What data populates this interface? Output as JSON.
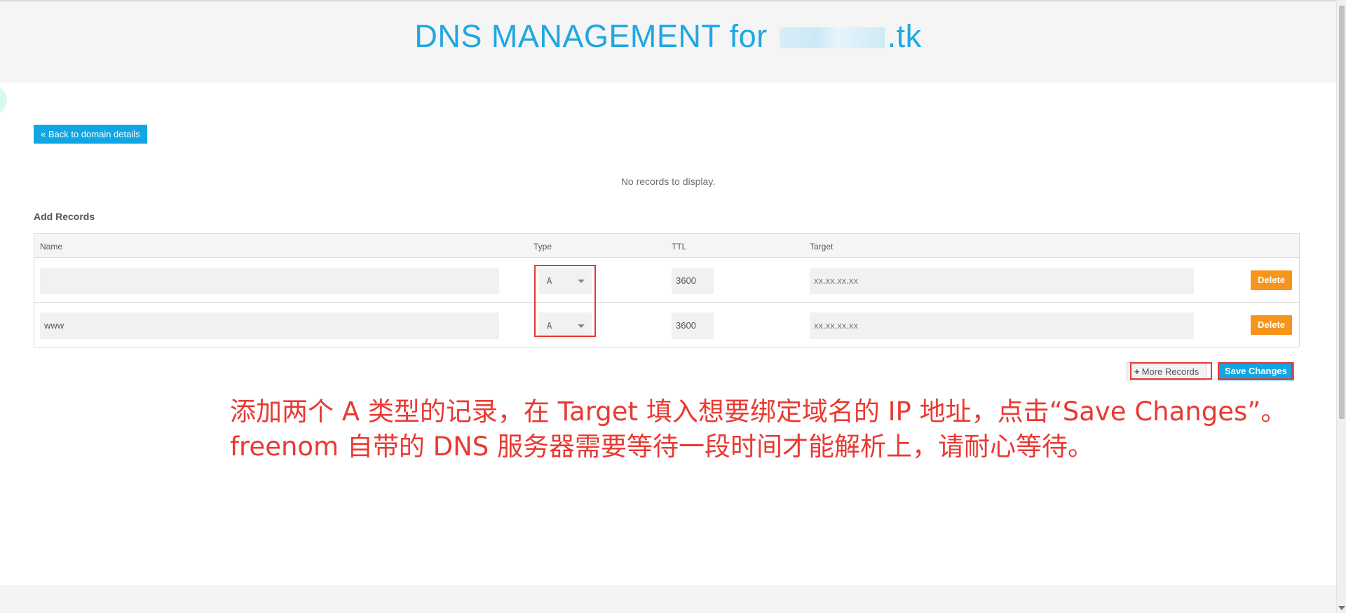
{
  "header": {
    "title_prefix": "DNS MANAGEMENT for ",
    "title_suffix": ".tk"
  },
  "nav": {
    "back_label": "« Back to domain details"
  },
  "records": {
    "empty_message": "No records to display."
  },
  "add_records": {
    "title": "Add Records",
    "columns": [
      "Name",
      "Type",
      "TTL",
      "Target"
    ],
    "rows": [
      {
        "name": "",
        "type": "A",
        "ttl": "3600",
        "target_placeholder": "xx.xx.xx.xx",
        "delete_label": "Delete"
      },
      {
        "name": "www",
        "type": "A",
        "ttl": "3600",
        "target_placeholder": "xx.xx.xx.xx",
        "delete_label": "Delete"
      }
    ],
    "more_records_label": "More Records",
    "save_label": "Save Changes"
  },
  "annotation": {
    "line1": "添加两个 A 类型的记录，在 Target 填入想要绑定域名的 IP 地址，点击“Save Changes”。",
    "line2": "freenom 自带的 DNS 服务器需要等待一段时间才能解析上，请耐心等待。"
  },
  "colors": {
    "accent_blue": "#10a6e3",
    "title_blue": "#1fa7e1",
    "delete_orange": "#f7941d",
    "annotation_red": "#e83a32"
  },
  "icons": {
    "plus": "plus-icon",
    "dropdown": "chevron-down-icon"
  }
}
